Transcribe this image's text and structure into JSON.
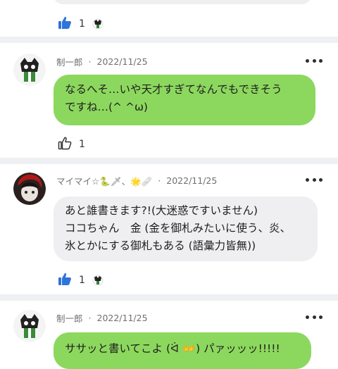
{
  "colors": {
    "like_blue": "#2f74d8",
    "bubble_green": "#8cd85e",
    "bubble_gray": "#efeff1"
  },
  "top_reaction": {
    "count": "1",
    "icon": "thumbs-up-filled"
  },
  "comments": [
    {
      "author": "制一郎",
      "date": "2022/11/25",
      "bubble_lines": [
        "なるへそ…いや天才すぎてなんでもできそう",
        "ですね…(^ ^ω)"
      ],
      "likes": {
        "count": "1",
        "icon": "thumbs-up-outline"
      }
    },
    {
      "author": "マイマイ☆",
      "author_emoji": "🐍🗡、🌟🩹",
      "date": "2022/11/25",
      "bubble_lines": [
        "あと誰書きます?!(大迷惑ですいません)",
        "ココちゃん　金 (金を御札みたいに使う、炎、",
        "氷とかにする御札もある (語彙力皆無))"
      ],
      "likes": {
        "count": "1",
        "icon": "thumbs-up-filled"
      }
    },
    {
      "author": "制一郎",
      "date": "2022/11/25",
      "bubble_lines": [
        "ササッと書いてこよ (ᐛ 👐) パァッッッ!!!!!"
      ]
    }
  ]
}
